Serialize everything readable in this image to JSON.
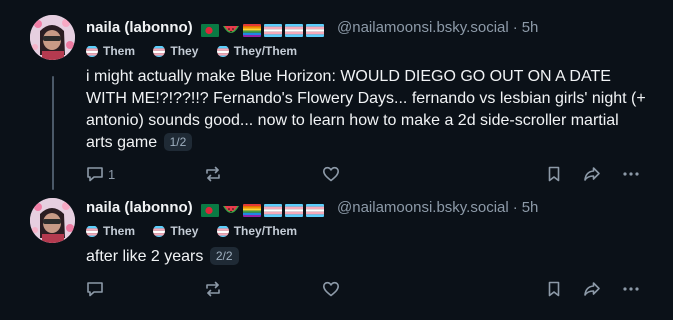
{
  "posts": [
    {
      "author": {
        "display_name": "naila (labonno)",
        "handle": "@nailamoonsi.bsky.social",
        "flags": [
          "flag-bangladesh-icon",
          "watermelon-icon",
          "rainbow-flag-icon",
          "trans-flag-icon",
          "trans-flag-icon",
          "trans-flag-icon"
        ]
      },
      "time": "5h",
      "separator": "·",
      "pronouns": [
        "Them",
        "They",
        "They/Them"
      ],
      "text": "i might actually make Blue Horizon: WOULD DIEGO GO OUT ON A DATE WITH ME!?!??!!? Fernando's Flowery Days... fernando vs lesbian girls' night (+ antonio) sounds good... now to learn how to make a 2d side-scroller martial arts game",
      "counter": "1/2",
      "reply_count": "1"
    },
    {
      "author": {
        "display_name": "naila (labonno)",
        "handle": "@nailamoonsi.bsky.social",
        "flags": [
          "flag-bangladesh-icon",
          "watermelon-icon",
          "rainbow-flag-icon",
          "trans-flag-icon",
          "trans-flag-icon",
          "trans-flag-icon"
        ]
      },
      "time": "5h",
      "separator": "·",
      "pronouns": [
        "Them",
        "They",
        "They/Them"
      ],
      "text": "after like 2 years",
      "counter": "2/2",
      "reply_count": ""
    }
  ],
  "colors": {
    "background": "#0b1118",
    "muted": "#8d9aa8",
    "text": "#f1f3f5",
    "thread_line": "#4b5968"
  },
  "icons": [
    "reply-icon",
    "repost-icon",
    "like-icon",
    "bookmark-icon",
    "share-icon",
    "more-icon"
  ]
}
